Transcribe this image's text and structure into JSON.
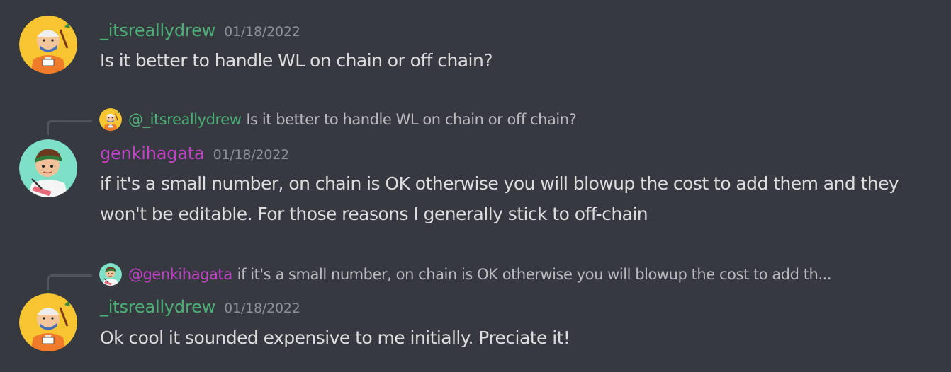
{
  "colors": {
    "background": "#36393f",
    "text": "#dcddde",
    "timestamp": "#8e9297",
    "user_itsreallydrew": "#4caf78",
    "user_genkihagata": "#c242c9",
    "reply_text": "#b9bbbe",
    "reply_spine": "#4f545c"
  },
  "messages": [
    {
      "username": "_itsreallydrew",
      "timestamp": "01/18/2022",
      "content": "Is it better to handle WL on chain or off chain?",
      "avatar_icon": "itsreallydrew-avatar-icon"
    },
    {
      "reply": {
        "mention": "@_itsreallydrew",
        "preview": "Is it better to handle WL on chain or off chain?",
        "avatar_icon": "itsreallydrew-avatar-icon"
      },
      "username": "genkihagata",
      "timestamp": "01/18/2022",
      "content": "if it's a small number, on chain is OK otherwise you will blowup the cost to add them and they won't be editable. For those reasons I generally stick to off-chain",
      "avatar_icon": "genkihagata-avatar-icon"
    },
    {
      "reply": {
        "mention": "@genkihagata",
        "preview": "if it's a small number, on chain is OK otherwise you will blowup the cost to add th...",
        "avatar_icon": "genkihagata-avatar-icon"
      },
      "username": "_itsreallydrew",
      "timestamp": "01/18/2022",
      "content": "Ok cool it sounded expensive to me initially. Preciate it!",
      "avatar_icon": "itsreallydrew-avatar-icon"
    }
  ]
}
